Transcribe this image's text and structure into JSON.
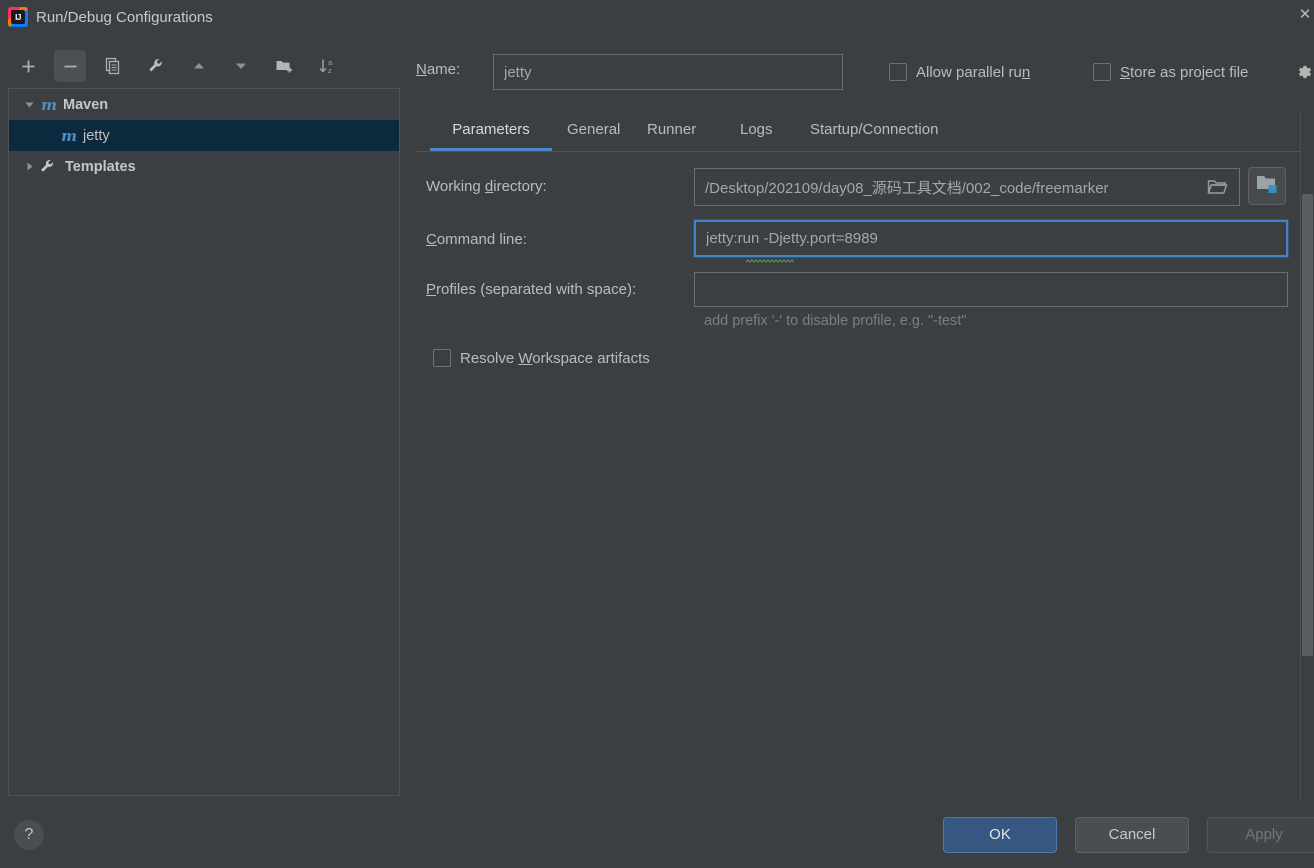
{
  "window": {
    "title": "Run/Debug Configurations",
    "app_icon": "intellij-idea-icon",
    "close_icon": "close-icon"
  },
  "toolbar": {
    "buttons": [
      {
        "name": "add-configuration-button",
        "icon": "plus-icon",
        "active": false
      },
      {
        "name": "remove-configuration-button",
        "icon": "minus-icon",
        "active": true
      },
      {
        "name": "copy-configuration-button",
        "icon": "copy-icon",
        "active": false
      },
      {
        "name": "edit-templates-button",
        "icon": "wrench-icon",
        "active": false
      },
      {
        "name": "move-up-button",
        "icon": "arrow-up-icon",
        "active": false
      },
      {
        "name": "move-down-button",
        "icon": "arrow-down-icon",
        "active": false
      },
      {
        "name": "new-folder-button",
        "icon": "folder-plus-icon",
        "active": false
      },
      {
        "name": "sort-alphabetically-button",
        "icon": "sort-az-icon",
        "active": false
      }
    ]
  },
  "tree": {
    "items": [
      {
        "label": "Maven",
        "icon": "maven-m-icon",
        "twisty": "expanded",
        "bold": true,
        "selected": false,
        "depth": 0
      },
      {
        "label": "jetty",
        "icon": "maven-m-icon",
        "twisty": "none",
        "bold": false,
        "selected": true,
        "depth": 1
      },
      {
        "label": "Templates",
        "icon": "wrench-icon",
        "twisty": "collapsed",
        "bold": true,
        "selected": false,
        "depth": 0
      }
    ]
  },
  "name_field": {
    "label": "Name:",
    "label_mnemonic": "N",
    "value": "jetty"
  },
  "options": {
    "allow_parallel_run": {
      "label": "Allow parallel run",
      "label_mnemonic": "n",
      "checked": false
    },
    "store_as_project_file": {
      "label": "Store as project file",
      "label_mnemonic": "S",
      "checked": false
    },
    "gear_icon": "gear-icon"
  },
  "tabs": [
    {
      "label": "Parameters",
      "active": true
    },
    {
      "label": "General",
      "active": false
    },
    {
      "label": "Runner",
      "active": false
    },
    {
      "label": "Logs",
      "active": false
    },
    {
      "label": "Startup/Connection",
      "active": false
    }
  ],
  "parameters": {
    "working_directory": {
      "label": "Working directory:",
      "label_mnemonic": "d",
      "value": "/Desktop/202109/day08_源码工具文档/002_code/freemarker",
      "browse_icon": "folder-open-icon",
      "macro_icon": "folder-module-icon"
    },
    "command_line": {
      "label": "Command line:",
      "label_mnemonic": "C",
      "value": "jetty:run -Djetty.port=8989",
      "focused": true
    },
    "profiles": {
      "label": "Profiles (separated with space):",
      "label_mnemonic": "P",
      "value": "",
      "placeholder": "",
      "hint": "add prefix '-' to disable profile, e.g. \"-test\""
    },
    "resolve_workspace_artifacts": {
      "label": "Resolve Workspace artifacts",
      "label_mnemonic": "W",
      "checked": false
    }
  },
  "footer": {
    "help_label": "?",
    "ok_label": "OK",
    "cancel_label": "Cancel",
    "apply_label": "Apply",
    "apply_enabled": false
  },
  "colors": {
    "background": "#3c3f41",
    "selection": "#0d293e",
    "accent": "#4a88c7",
    "default_button": "#365880",
    "maven_icon": "#4a90c4"
  }
}
